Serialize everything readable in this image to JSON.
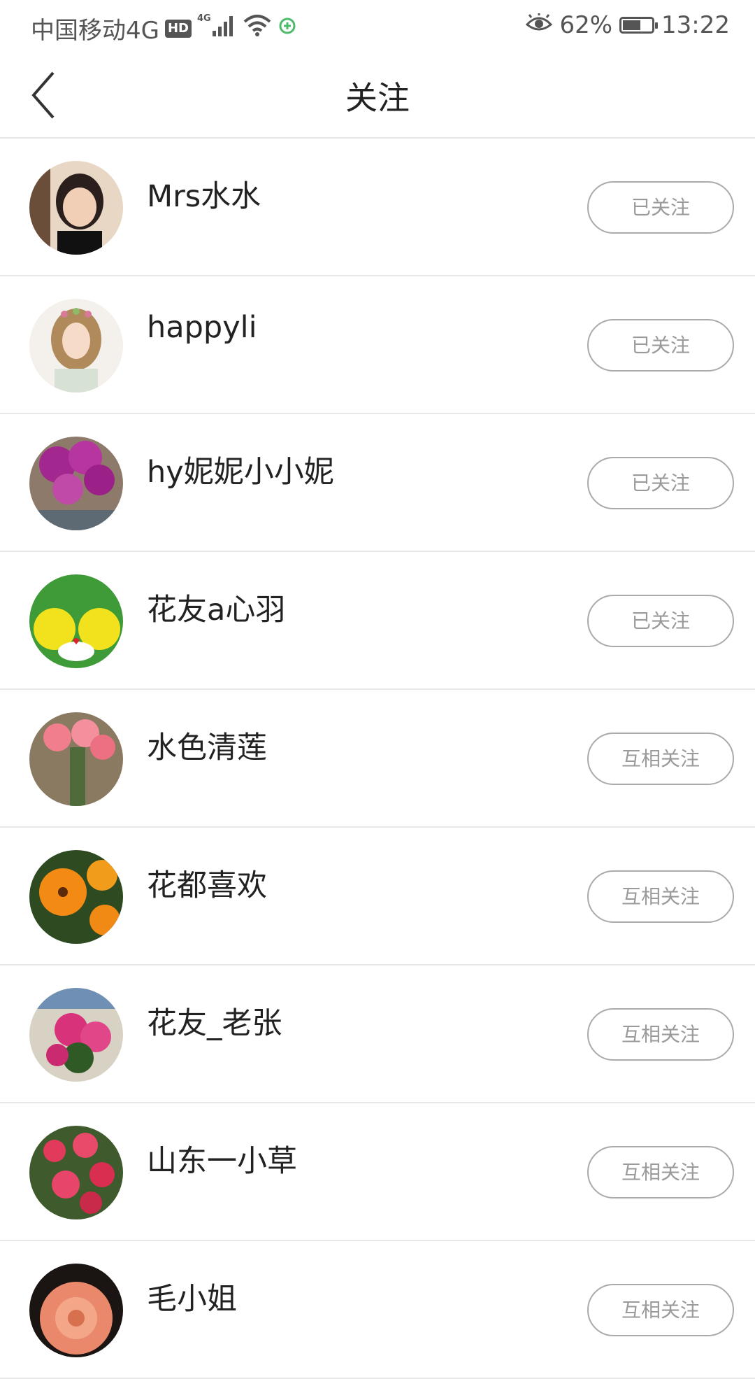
{
  "status_bar": {
    "carrier": "中国移动4G",
    "hd_badge": "HD",
    "network": "4G",
    "battery_percent": "62%",
    "battery_level": 0.62,
    "time": "13:22"
  },
  "header": {
    "title": "关注"
  },
  "follow_list": [
    {
      "name": "Mrs水水",
      "button": "已关注"
    },
    {
      "name": "happyli",
      "button": "已关注"
    },
    {
      "name": "hy妮妮小小妮",
      "button": "已关注"
    },
    {
      "name": "花友a心羽",
      "button": "已关注"
    },
    {
      "name": "水色清莲",
      "button": "互相关注"
    },
    {
      "name": "花都喜欢",
      "button": "互相关注"
    },
    {
      "name": "花友_老张",
      "button": "互相关注"
    },
    {
      "name": "山东一小草",
      "button": "互相关注"
    },
    {
      "name": "毛小姐",
      "button": "互相关注"
    }
  ]
}
